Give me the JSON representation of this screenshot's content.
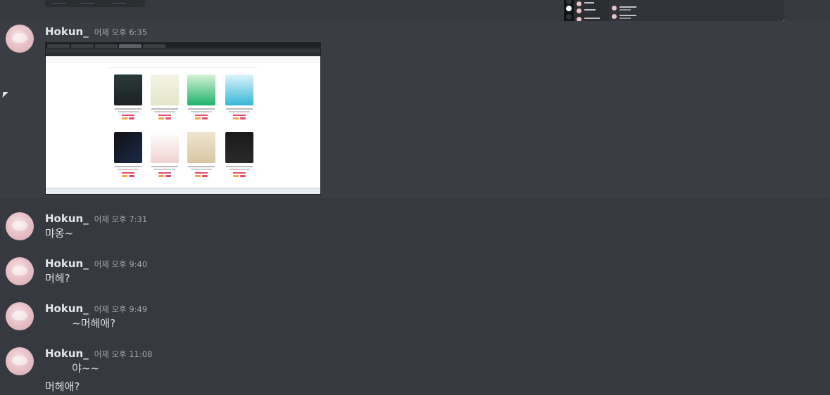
{
  "messages": [
    {
      "username": "Hokun_",
      "timestamp": "어제 오후 6:35",
      "content": ""
    },
    {
      "username": "Hokun_",
      "timestamp": "어제 오후 7:31",
      "content": "먀옹~"
    },
    {
      "username": "Hokun_",
      "timestamp": "어제 오후 9:40",
      "content": "머헤?"
    },
    {
      "username": "Hokun_",
      "timestamp": "어제 오후 9:49",
      "content": "        ~머헤애?"
    },
    {
      "username": "Hokun_",
      "timestamp": "어제 오후 11:08",
      "content": "        야~~",
      "content2": "머헤애?"
    }
  ],
  "icons": {
    "reply": "reply-icon",
    "more": "more-options-icon",
    "cursor": "mouse-cursor-icon"
  },
  "symbols": {
    "reply_glyph": "↩",
    "more_glyph": "•••"
  },
  "colors": {
    "background": "#36393f",
    "highlight": "#3a3d43",
    "username": "#e3e5e8",
    "timestamp": "#a3a6aa",
    "price_accent": "#e64a6b",
    "online_green": "#23a55a"
  }
}
